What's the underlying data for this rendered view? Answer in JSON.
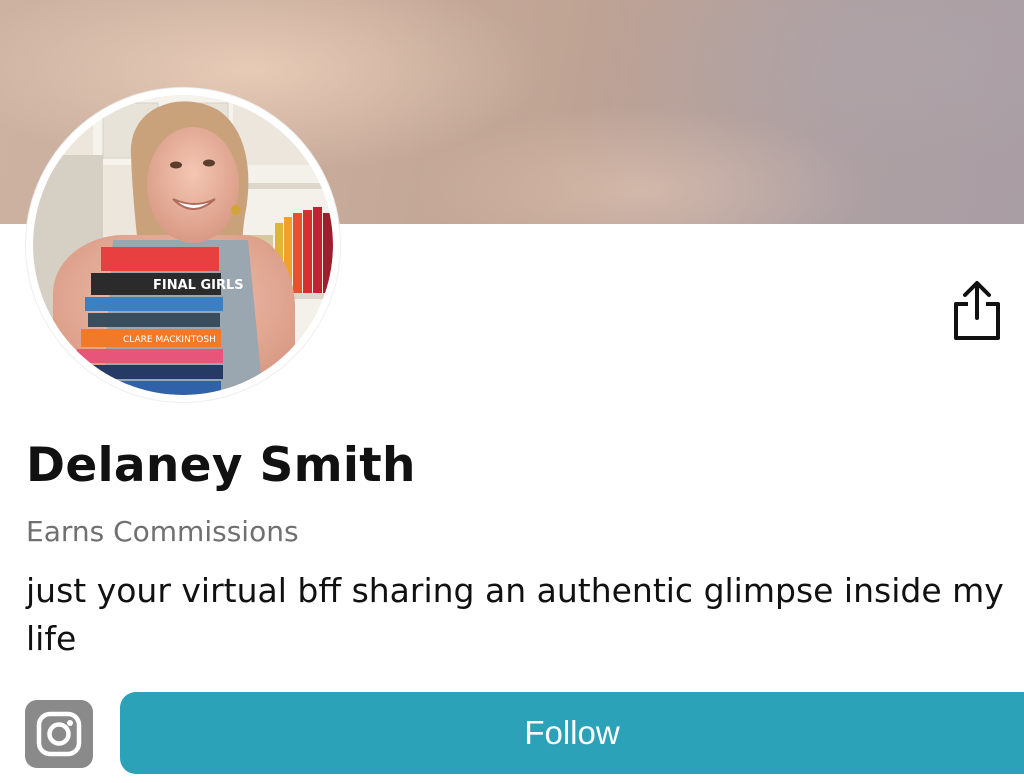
{
  "profile": {
    "name": "Delaney Smith",
    "badge": "Earns Commissions",
    "bio": "just your virtual bff sharing an authentic glimpse inside my life"
  },
  "actions": {
    "follow_label": "Follow",
    "share_icon": "share-icon",
    "social_icon": "instagram-icon"
  },
  "colors": {
    "follow_button": "#2ba2b8",
    "instagram_icon_bg": "#8a8a8a"
  }
}
